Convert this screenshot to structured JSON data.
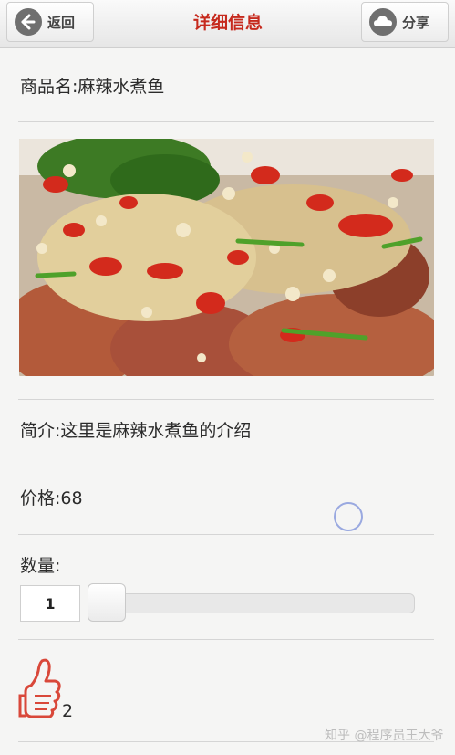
{
  "header": {
    "back_label": "返回",
    "title": "详细信息",
    "share_label": "分享",
    "back_icon": "back-arrow-icon",
    "share_icon": "cloud-icon"
  },
  "product": {
    "name": "商品名:麻辣水煮鱼",
    "intro": "简介:这里是麻辣水煮鱼的介绍",
    "price": "价格:68",
    "quantity_label": "数量:",
    "quantity_value": "1",
    "quantity_slider_fraction": 0,
    "like_count": "2",
    "like_icon": "thumbs-up-icon"
  },
  "colors": {
    "accent": "#c62a1e",
    "like_icon": "#d9483a"
  },
  "watermark": "知乎 @程序员王大爷"
}
